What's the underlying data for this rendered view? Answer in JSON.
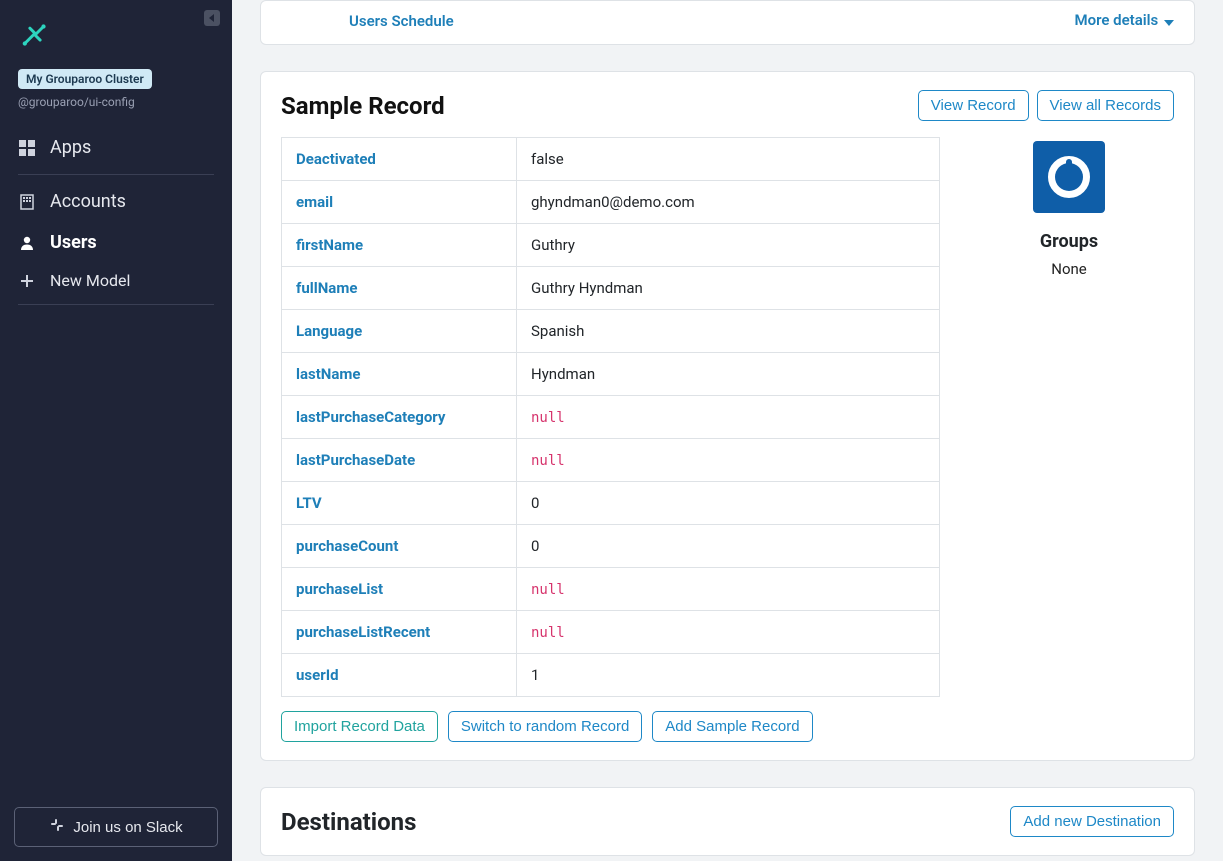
{
  "sidebar": {
    "cluster_badge": "My Grouparoo Cluster",
    "cluster_sub": "@grouparoo/ui-config",
    "items": {
      "apps": "Apps",
      "accounts": "Accounts",
      "users": "Users",
      "new_model": "New Model"
    },
    "slack_button": "Join us on Slack"
  },
  "top_fragment": {
    "schedule_link": "Users Schedule",
    "more_details": "More details"
  },
  "sample": {
    "title": "Sample Record",
    "view_record": "View Record",
    "view_all": "View all Records",
    "groups_title": "Groups",
    "groups_none": "None",
    "null_label": "null",
    "properties": [
      {
        "key": "Deactivated",
        "value": "false",
        "isNull": false
      },
      {
        "key": "email",
        "value": "ghyndman0@demo.com",
        "isNull": false
      },
      {
        "key": "firstName",
        "value": "Guthry",
        "isNull": false
      },
      {
        "key": "fullName",
        "value": "Guthry Hyndman",
        "isNull": false
      },
      {
        "key": "Language",
        "value": "Spanish",
        "isNull": false
      },
      {
        "key": "lastName",
        "value": "Hyndman",
        "isNull": false
      },
      {
        "key": "lastPurchaseCategory",
        "value": "",
        "isNull": true
      },
      {
        "key": "lastPurchaseDate",
        "value": "",
        "isNull": true
      },
      {
        "key": "LTV",
        "value": "0",
        "isNull": false
      },
      {
        "key": "purchaseCount",
        "value": "0",
        "isNull": false
      },
      {
        "key": "purchaseList",
        "value": "",
        "isNull": true
      },
      {
        "key": "purchaseListRecent",
        "value": "",
        "isNull": true
      },
      {
        "key": "userId",
        "value": "1",
        "isNull": false
      }
    ],
    "actions": {
      "import": "Import Record Data",
      "random": "Switch to random Record",
      "add": "Add Sample Record"
    }
  },
  "destinations": {
    "title": "Destinations",
    "add_button": "Add new Destination"
  }
}
